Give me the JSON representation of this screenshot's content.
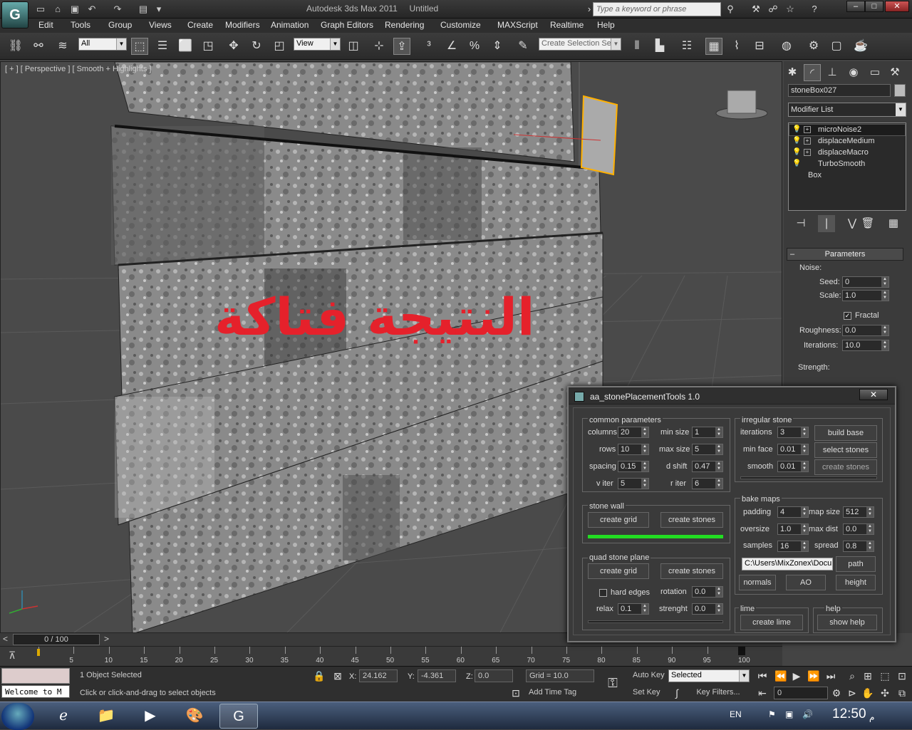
{
  "window": {
    "app_title": "Autodesk 3ds Max  2011",
    "doc_title": "Untitled",
    "search_placeholder": "Type a keyword or phrase"
  },
  "menu": [
    "Edit",
    "Tools",
    "Group",
    "Views",
    "Create",
    "Modifiers",
    "Animation",
    "Graph Editors",
    "Rendering",
    "Customize",
    "MAXScript",
    "Realtime",
    "Help"
  ],
  "toolbar": {
    "selection_filter": "All",
    "ref_coord": "View",
    "named_selection_placeholder": "Create Selection Se"
  },
  "viewport": {
    "label": "[ + ] [ Perspective ] [ Smooth + Highlights ]",
    "overlay_text": "النتيجة فتاكة"
  },
  "command_panel": {
    "object_name": "stoneBox027",
    "modifier_list": "Modifier List",
    "stack": [
      "microNoise2",
      "displaceMedium",
      "displaceMacro",
      "TurboSmooth",
      "Box"
    ],
    "rollout_title": "Parameters",
    "noise_label": "Noise:",
    "seed_label": "Seed:",
    "seed": "0",
    "scale_label": "Scale:",
    "scale": "1.0",
    "fractal_label": "Fractal",
    "roughness_label": "Roughness:",
    "roughness": "0.0",
    "iterations_label": "Iterations:",
    "iterations": "10.0",
    "strength_label": "Strength:"
  },
  "dialog": {
    "title": "aa_stonePlacementTools 1.0",
    "common": {
      "title": "common parameters",
      "columns_label": "columns",
      "columns": "20",
      "rows_label": "rows",
      "rows": "10",
      "spacing_label": "spacing",
      "spacing": "0.15",
      "v_iter_label": "v iter",
      "v_iter": "5",
      "min_size_label": "min size",
      "min_size": "1",
      "max_size_label": "max size",
      "max_size": "5",
      "d_shift_label": "d shift",
      "d_shift": "0.47",
      "r_iter_label": "r iter",
      "r_iter": "6"
    },
    "stone_wall": {
      "title": "stone wall",
      "create_grid": "create grid",
      "create_stones": "create stones",
      "progress": 1.0
    },
    "quad_plane": {
      "title": "quad stone plane",
      "create_grid": "create grid",
      "create_stones": "create stones",
      "hard_edges_label": "hard edges",
      "rotation_label": "rotation",
      "rotation": "0.0",
      "relax_label": "relax",
      "relax": "0.1",
      "strenght_label": "strenght",
      "strenght": "0.0"
    },
    "irregular": {
      "title": "irregular stone",
      "iterations_label": "iterations",
      "iterations": "3",
      "min_face_label": "min face",
      "min_face": "0.01",
      "smooth_label": "smooth",
      "smooth": "0.01",
      "build_base": "build base",
      "select_stones": "select stones",
      "create_stones": "create stones"
    },
    "bake": {
      "title": "bake maps",
      "padding_label": "padding",
      "padding": "4",
      "oversize_label": "oversize",
      "oversize": "1.0",
      "samples_label": "samples",
      "samples": "16",
      "map_size_label": "map size",
      "map_size": "512",
      "max_dist_label": "max dist",
      "max_dist": "0.0",
      "spread_label": "spread",
      "spread": "0.8",
      "path_value": "C:\\Users\\MixZonex\\Docu",
      "path_btn": "path",
      "normals": "normals",
      "ao": "AO",
      "height": "height"
    },
    "lime": {
      "title": "lime",
      "create_lime": "create lime"
    },
    "help": {
      "title": "help",
      "show_help": "show help"
    }
  },
  "timeline": {
    "frame_display": "0 / 100",
    "ticks": [
      "0",
      "5",
      "10",
      "15",
      "20",
      "25",
      "30",
      "35",
      "40",
      "45",
      "50",
      "55",
      "60",
      "65",
      "70",
      "75",
      "80",
      "85",
      "90",
      "95",
      "100"
    ]
  },
  "status": {
    "maxscript_listener": "Welcome to M",
    "selection": "1 Object Selected",
    "prompt": "Click or click-and-drag to select objects",
    "x_label": "X:",
    "x": "24.162",
    "y_label": "Y:",
    "y": "-4.361",
    "z_label": "Z:",
    "z": "0.0",
    "grid": "Grid = 10.0",
    "add_time_tag": "Add Time Tag",
    "auto_key": "Auto Key",
    "set_key": "Set Key",
    "key_mode": "Selected",
    "key_filters": "Key Filters...",
    "frame": "0"
  },
  "taskbar": {
    "lang": "EN",
    "clock": "12:50",
    "clock_suffix": "م"
  },
  "colors": {
    "overlay_red": "#e5212b",
    "progress_green": "#22dd22",
    "selection_orange": "#ffb000"
  }
}
